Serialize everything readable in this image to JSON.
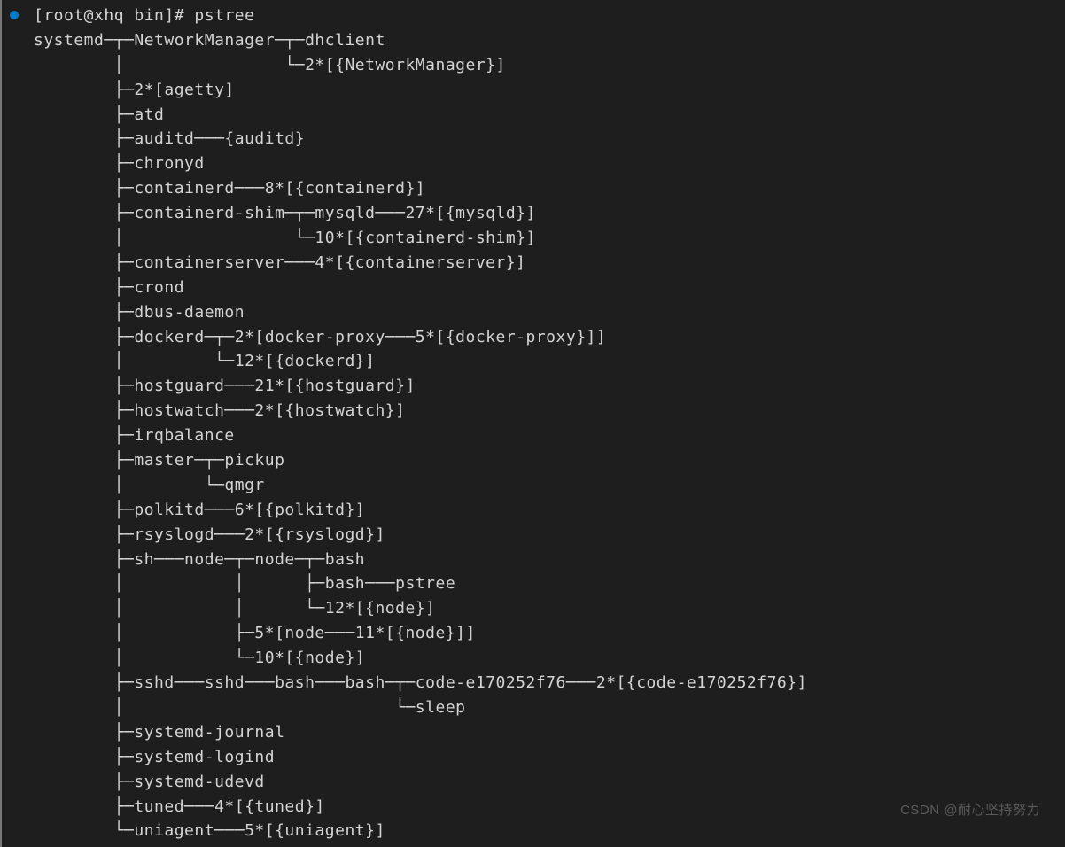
{
  "prompt": "[root@xhq bin]# pstree",
  "lines": [
    "systemd─┬─NetworkManager─┬─dhclient",
    "        │                └─2*[{NetworkManager}]",
    "        ├─2*[agetty]",
    "        ├─atd",
    "        ├─auditd───{auditd}",
    "        ├─chronyd",
    "        ├─containerd───8*[{containerd}]",
    "        ├─containerd-shim─┬─mysqld───27*[{mysqld}]",
    "        │                 └─10*[{containerd-shim}]",
    "        ├─containerserver───4*[{containerserver}]",
    "        ├─crond",
    "        ├─dbus-daemon",
    "        ├─dockerd─┬─2*[docker-proxy───5*[{docker-proxy}]]",
    "        │         └─12*[{dockerd}]",
    "        ├─hostguard───21*[{hostguard}]",
    "        ├─hostwatch───2*[{hostwatch}]",
    "        ├─irqbalance",
    "        ├─master─┬─pickup",
    "        │        └─qmgr",
    "        ├─polkitd───6*[{polkitd}]",
    "        ├─rsyslogd───2*[{rsyslogd}]",
    "        ├─sh───node─┬─node─┬─bash",
    "        │           │      ├─bash───pstree",
    "        │           │      └─12*[{node}]",
    "        │           ├─5*[node───11*[{node}]]",
    "        │           └─10*[{node}]",
    "        ├─sshd───sshd───bash───bash─┬─code-e170252f76───2*[{code-e170252f76}]",
    "        │                           └─sleep",
    "        ├─systemd-journal",
    "        ├─systemd-logind",
    "        ├─systemd-udevd",
    "        ├─tuned───4*[{tuned}]",
    "        └─uniagent───5*[{uniagent}]"
  ],
  "watermark": "CSDN @耐心坚持努力"
}
